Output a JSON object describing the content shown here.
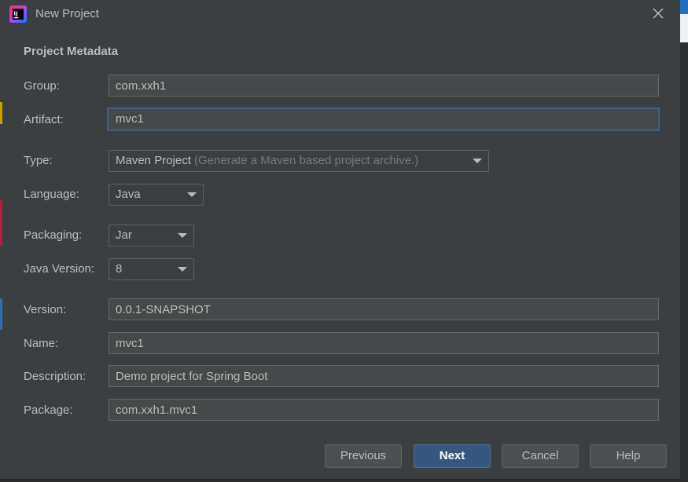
{
  "window": {
    "title": "New Project",
    "icon": "intellij-idea-icon",
    "close_icon": "close-icon"
  },
  "form": {
    "section_title": "Project Metadata",
    "group": {
      "label": "Group:",
      "value": "com.xxh1"
    },
    "artifact": {
      "label": "Artifact:",
      "value": "mvc1"
    },
    "type": {
      "label": "Type:",
      "value": "Maven Project",
      "hint": "(Generate a Maven based project archive.)"
    },
    "language": {
      "label": "Language:",
      "value": "Java"
    },
    "packaging": {
      "label": "Packaging:",
      "value": "Jar"
    },
    "java_version": {
      "label": "Java Version:",
      "value": "8"
    },
    "version": {
      "label": "Version:",
      "value": "0.0.1-SNAPSHOT"
    },
    "name": {
      "label": "Name:",
      "value": "mvc1"
    },
    "description": {
      "label": "Description:",
      "value": "Demo project for Spring Boot"
    },
    "package": {
      "label": "Package:",
      "value": "com.xxh1.mvc1"
    }
  },
  "buttons": {
    "previous": "Previous",
    "next": "Next",
    "cancel": "Cancel",
    "help": "Help"
  },
  "colors": {
    "background": "#3c3f41",
    "field_bg": "#45494a",
    "focus_border": "#3d6185",
    "primary_button": "#365880",
    "text": "#bbbbbb"
  }
}
